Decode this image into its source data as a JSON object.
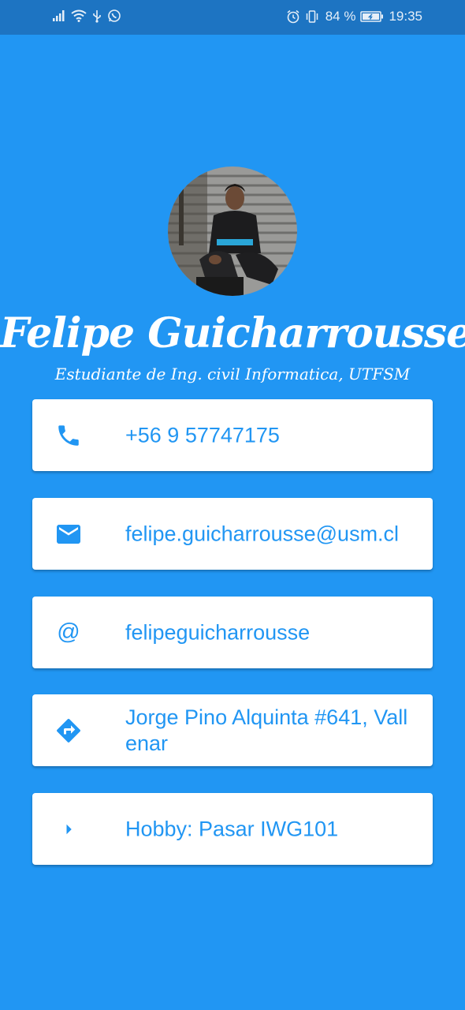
{
  "status_bar": {
    "battery_percent": "84 %",
    "time": "19:35",
    "left_icons": [
      "signal-icon",
      "wifi-icon",
      "usb-icon",
      "whatsapp-icon"
    ],
    "right_icons": [
      "alarm-icon",
      "vibrate-icon",
      "battery-icon"
    ]
  },
  "profile": {
    "name": "Felipe Guicharrousse",
    "subtitle": "Estudiante de Ing. civil Informatica, UTFSM",
    "avatar": "profile-photo"
  },
  "cards": [
    {
      "icon": "phone-icon",
      "text": "+56 9 57747175"
    },
    {
      "icon": "mail-icon",
      "text": "felipe.guicharrousse@usm.cl"
    },
    {
      "icon": "at-icon",
      "glyph": "@",
      "text": "felipeguicharrousse"
    },
    {
      "icon": "directions-icon",
      "text": "Jorge Pino Alquinta #641, Vallenar"
    },
    {
      "icon": "arrow-right-icon",
      "text": "Hobby: Pasar IWG101"
    }
  ],
  "colors": {
    "background": "#2196F3",
    "status_bar": "#1D74C2",
    "card": "#FFFFFF",
    "accent": "#2196F3"
  }
}
